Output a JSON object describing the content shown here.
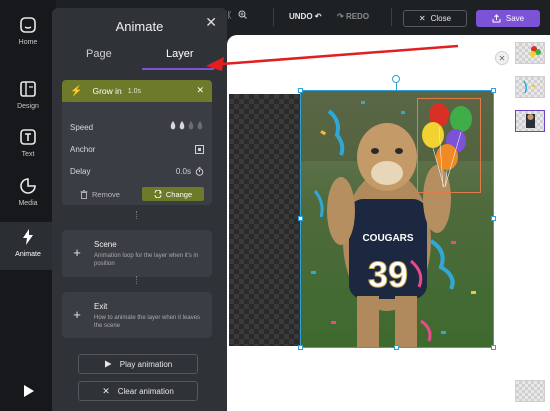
{
  "rail": {
    "items": [
      {
        "label": "Home",
        "icon": "home-icon"
      },
      {
        "label": "Design",
        "icon": "layout-icon"
      },
      {
        "label": "Text",
        "icon": "text-icon"
      },
      {
        "label": "Media",
        "icon": "media-icon"
      },
      {
        "label": "Animate",
        "icon": "bolt-icon"
      }
    ]
  },
  "panel": {
    "title": "Animate",
    "tabs": [
      {
        "label": "Page"
      },
      {
        "label": "Layer"
      }
    ],
    "active_tab": "Layer",
    "animation": {
      "name": "Grow in",
      "duration": "1.0s",
      "speed_label": "Speed",
      "anchor_label": "Anchor",
      "delay_label": "Delay",
      "delay_value": "0.0s",
      "speed_level": 2,
      "speed_max": 4,
      "remove_label": "Remove",
      "change_label": "Change"
    },
    "scene": {
      "title": "Scene",
      "description": "Animation loop for the layer when it's in position"
    },
    "exit": {
      "title": "Exit",
      "description": "How to animate the layer when it leaves the scene"
    },
    "play_label": "Play animation",
    "clear_label": "Clear animation"
  },
  "toolbar": {
    "undo_label": "UNDO",
    "redo_label": "REDO",
    "close_label": "Close",
    "save_label": "Save"
  },
  "photo": {
    "jersey_text": "COUGARS",
    "jersey_number": "39"
  },
  "colors": {
    "accent": "#7c52d6",
    "animation_card": "#6d7a2a",
    "selection": "#2f9fd8",
    "arrow": "#e02020"
  }
}
